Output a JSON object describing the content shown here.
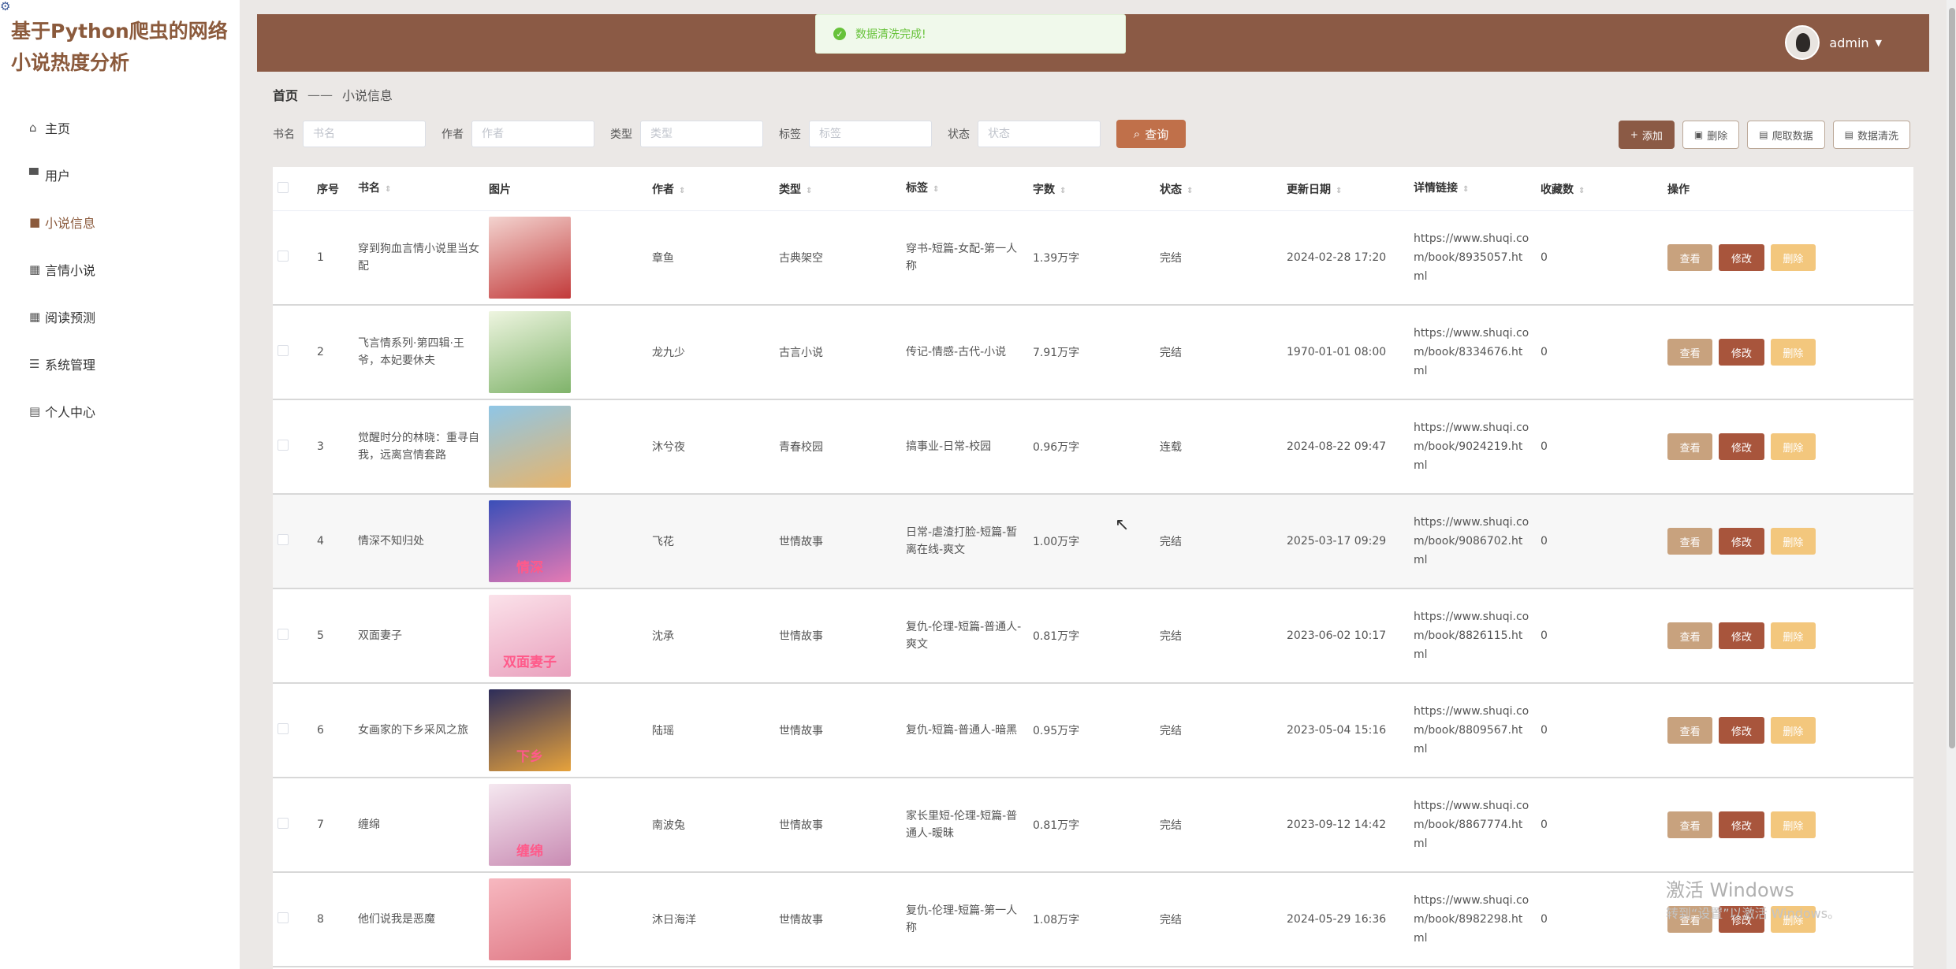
{
  "app": {
    "title": "基于Python爬虫的网络小说热度分析"
  },
  "sidebar": {
    "items": [
      {
        "label": "主页",
        "icon": "home-icon",
        "glyph": "⌂"
      },
      {
        "label": "用户",
        "icon": "monitor-icon",
        "glyph": "▀"
      },
      {
        "label": "小说信息",
        "icon": "book-icon",
        "glyph": "■"
      },
      {
        "label": "言情小说",
        "icon": "grid-icon",
        "glyph": "▦"
      },
      {
        "label": "阅读预测",
        "icon": "grid-icon",
        "glyph": "▦"
      },
      {
        "label": "系统管理",
        "icon": "list-icon",
        "glyph": "☰"
      },
      {
        "label": "个人中心",
        "icon": "profile-icon",
        "glyph": "▤"
      }
    ],
    "active_index": 2
  },
  "header": {
    "toast": "数据清洗完成!",
    "user": "admin"
  },
  "breadcrumb": {
    "home": "首页",
    "separator": "——",
    "current": "小说信息"
  },
  "search": {
    "fields": [
      {
        "label": "书名",
        "placeholder": "书名"
      },
      {
        "label": "作者",
        "placeholder": "作者"
      },
      {
        "label": "类型",
        "placeholder": "类型"
      },
      {
        "label": "标签",
        "placeholder": "标签"
      },
      {
        "label": "状态",
        "placeholder": "状态"
      }
    ],
    "query_label": "查询"
  },
  "toolbar": {
    "add": "添加",
    "delete": "删除",
    "crawl": "爬取数据",
    "clean": "数据清洗"
  },
  "table": {
    "headers": {
      "no": "序号",
      "name": "书名",
      "img": "图片",
      "author": "作者",
      "type": "类型",
      "tags": "标签",
      "words": "字数",
      "status": "状态",
      "date": "更新日期",
      "link": "详情链接",
      "fav": "收藏数",
      "ops": "操作"
    },
    "op_labels": {
      "view": "查看",
      "edit": "修改",
      "del": "删除"
    },
    "rows": [
      {
        "no": "1",
        "name": "穿到狗血言情小说里当女配",
        "author": "章鱼",
        "type": "古典架空",
        "tags": "穿书-短篇-女配-第一人称",
        "words": "1.39万字",
        "status": "完结",
        "date": "2024-02-28 17:20",
        "link": "https://www.shuqi.com/book/8935057.html",
        "fav": "0",
        "cover": [
          "#f3d3cf",
          "#c23a3a"
        ],
        "cover_text": ""
      },
      {
        "no": "2",
        "name": "飞言情系列·第四辑·王爷，本妃要休夫",
        "author": "龙九少",
        "type": "古言小说",
        "tags": "传记-情感-古代-小说",
        "words": "7.91万字",
        "status": "完结",
        "date": "1970-01-01 08:00",
        "link": "https://www.shuqi.com/book/8334676.html",
        "fav": "0",
        "cover": [
          "#eef5e0",
          "#7fb36a"
        ],
        "cover_text": ""
      },
      {
        "no": "3",
        "name": "觉醒时分的林晓：重寻自我，远离宫情套路",
        "author": "沐兮夜",
        "type": "青春校园",
        "tags": "搞事业-日常-校园",
        "words": "0.96万字",
        "status": "连载",
        "date": "2024-08-22 09:47",
        "link": "https://www.shuqi.com/book/9024219.html",
        "fav": "0",
        "cover": [
          "#8fc6e6",
          "#e8b46a"
        ],
        "cover_text": ""
      },
      {
        "no": "4",
        "name": "情深不知归处",
        "author": "飞花",
        "type": "世情故事",
        "tags": "日常-虐渣打脸-短篇-暂离在线-爽文",
        "words": "1.00万字",
        "status": "完结",
        "date": "2025-03-17 09:29",
        "link": "https://www.shuqi.com/book/9086702.html",
        "fav": "0",
        "cover": [
          "#3a4fb8",
          "#e57ab4"
        ],
        "cover_text": "情深"
      },
      {
        "no": "5",
        "name": "双面妻子",
        "author": "沈承",
        "type": "世情故事",
        "tags": "复仇-伦理-短篇-普通人-爽文",
        "words": "0.81万字",
        "status": "完结",
        "date": "2023-06-02 10:17",
        "link": "https://www.shuqi.com/book/8826115.html",
        "fav": "0",
        "cover": [
          "#fbe2ea",
          "#e9a0bd"
        ],
        "cover_text": "双面妻子"
      },
      {
        "no": "6",
        "name": "女画家的下乡采风之旅",
        "author": "陆瑶",
        "type": "世情故事",
        "tags": "复仇-短篇-普通人-暗黑",
        "words": "0.95万字",
        "status": "完结",
        "date": "2023-05-04 15:16",
        "link": "https://www.shuqi.com/book/8809567.html",
        "fav": "0",
        "cover": [
          "#2d2d5a",
          "#e6a23c"
        ],
        "cover_text": "下乡"
      },
      {
        "no": "7",
        "name": "缠绵",
        "author": "南波兔",
        "type": "世情故事",
        "tags": "家长里短-伦理-短篇-普通人-暧昧",
        "words": "0.81万字",
        "status": "完结",
        "date": "2023-09-12 14:42",
        "link": "https://www.shuqi.com/book/8867774.html",
        "fav": "0",
        "cover": [
          "#f5e8f0",
          "#c98bb3"
        ],
        "cover_text": "缠绵"
      },
      {
        "no": "8",
        "name": "他们说我是恶魔",
        "author": "沐日海洋",
        "type": "世情故事",
        "tags": "复仇-伦理-短篇-第一人称",
        "words": "1.08万字",
        "status": "完结",
        "date": "2024-05-29 16:36",
        "link": "https://www.shuqi.com/book/8982298.html",
        "fav": "0",
        "cover": [
          "#f7b8c0",
          "#e07a86"
        ],
        "cover_text": ""
      }
    ]
  },
  "watermark": {
    "line1": "激活 Windows",
    "line2": "转到“设置”以激活 Windows。"
  }
}
